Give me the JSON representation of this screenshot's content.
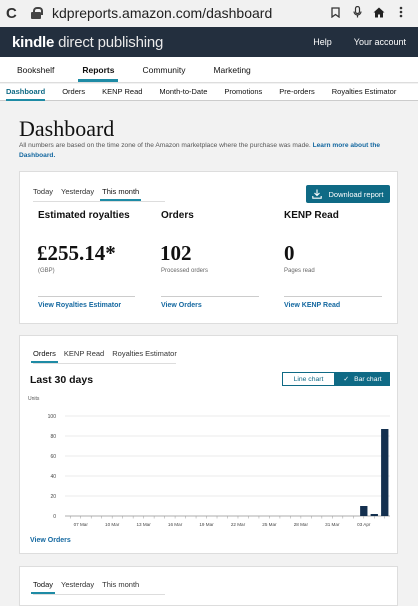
{
  "browser": {
    "url": "kdpreports.amazon.com/dashboard"
  },
  "header": {
    "logo_bold": "kindle",
    "logo_rest": "direct publishing",
    "help": "Help",
    "account": "Your account"
  },
  "main_nav": [
    "Bookshelf",
    "Reports",
    "Community",
    "Marketing"
  ],
  "sub_nav": [
    "Dashboard",
    "Orders",
    "KENP Read",
    "Month-to-Date",
    "Promotions",
    "Pre-orders",
    "Royalties Estimator"
  ],
  "page": {
    "title": "Dashboard",
    "note": "All numbers are based on the time zone of the Amazon marketplace where the purchase was made.",
    "note_link": "Learn more about the Dashboard."
  },
  "summary": {
    "tabs": [
      "Today",
      "Yesterday",
      "This month"
    ],
    "download": "Download report",
    "royalties": {
      "label": "Estimated royalties",
      "value": "£255.14*",
      "sub": "(GBP)",
      "link": "View Royalties Estimator"
    },
    "orders": {
      "label": "Orders",
      "value": "102",
      "sub": "Processed orders",
      "link": "View Orders"
    },
    "kenp": {
      "label": "KENP Read",
      "value": "0",
      "sub": "Pages read",
      "link": "View KENP Read"
    }
  },
  "chart_card": {
    "tabs": [
      "Orders",
      "KENP Read",
      "Royalties Estimator"
    ],
    "title": "Last 30 days",
    "line_chart": "Line chart",
    "bar_chart": "Bar chart",
    "link": "View Orders"
  },
  "chart_data": {
    "type": "bar",
    "ylabel": "Units",
    "ylim": [
      0,
      100
    ],
    "yticks": [
      0,
      20,
      40,
      60,
      80,
      100
    ],
    "xticks": [
      "07 Mar",
      "10 Mar",
      "13 Mar",
      "16 Mar",
      "19 Mar",
      "22 Mar",
      "25 Mar",
      "28 Mar",
      "31 Mar",
      "03 Apr"
    ],
    "bars": [
      {
        "day": 28,
        "value": 10
      },
      {
        "day": 29,
        "value": 2
      },
      {
        "day": 30,
        "value": 87
      }
    ],
    "days": 30,
    "color": "#14304f"
  },
  "bottom_card": {
    "tabs": [
      "Today",
      "Yesterday",
      "This month"
    ]
  },
  "colors": {
    "accent": "#1e8ba5",
    "button": "#0f6a85",
    "header": "#232f3e",
    "link": "#1468a0"
  }
}
